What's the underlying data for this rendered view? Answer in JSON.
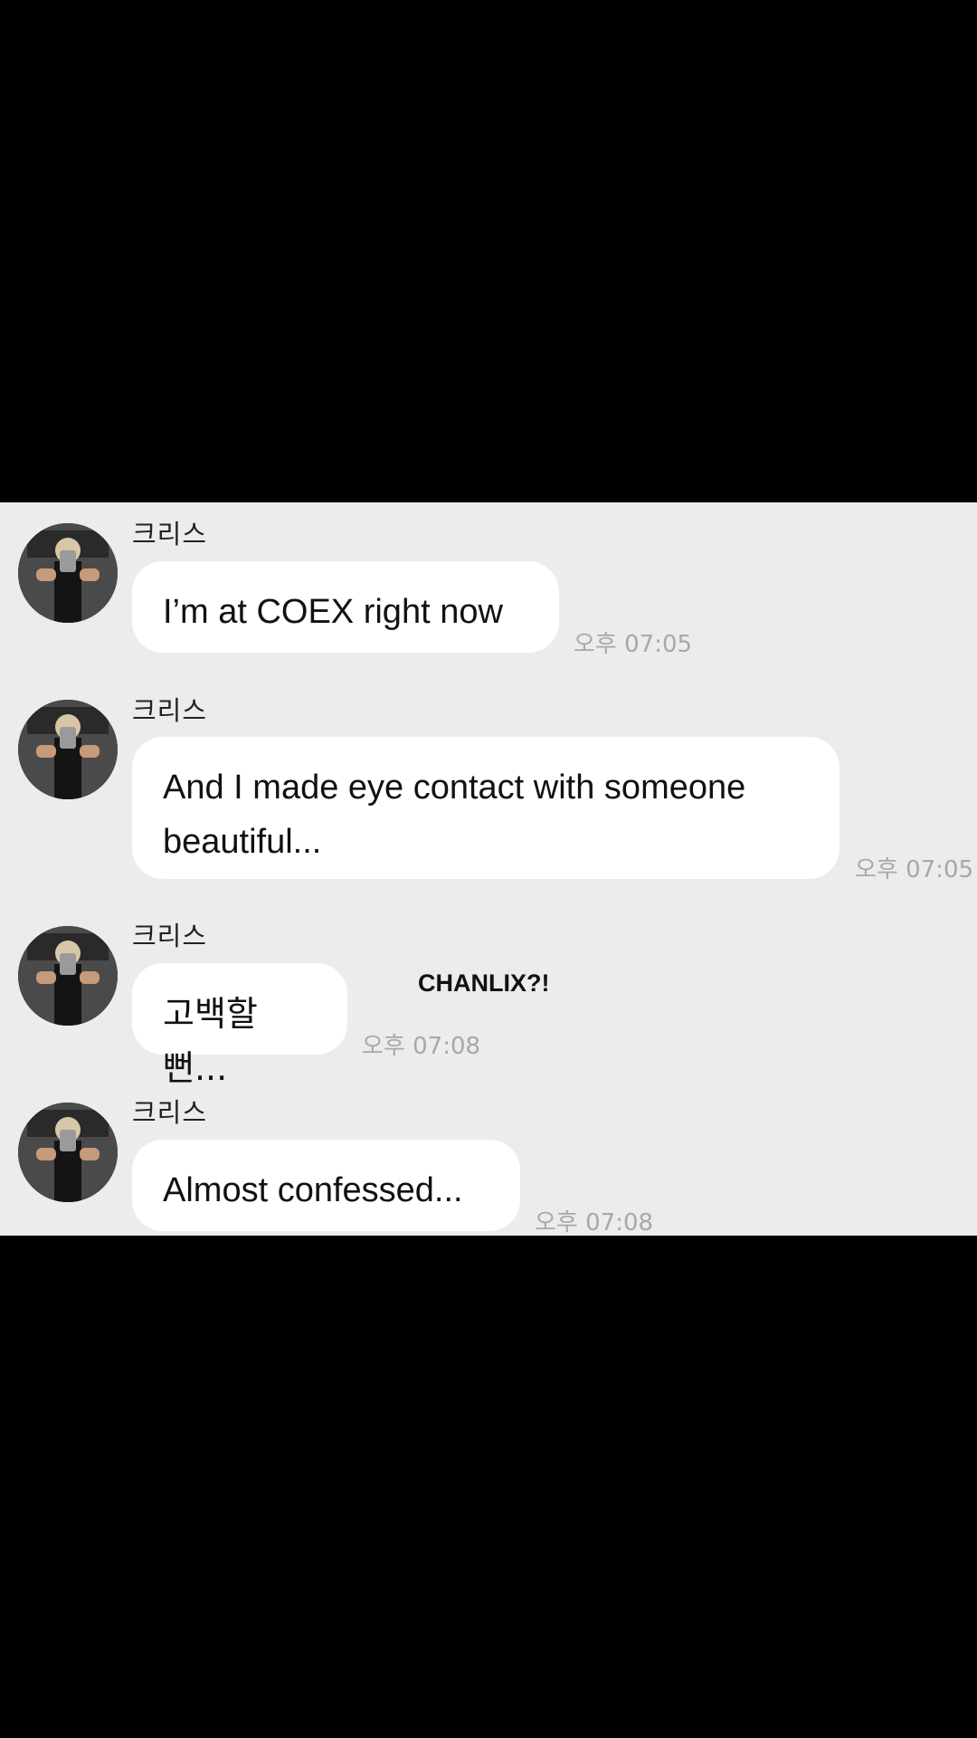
{
  "colors": {
    "background": "#000000",
    "chat_background": "#ececec",
    "bubble": "#ffffff",
    "timestamp": "#a8a8a8"
  },
  "messages": [
    {
      "sender": "크리스",
      "text": "I’m at COEX right now",
      "time": "오후 07:05",
      "avatar_icon": "user-avatar"
    },
    {
      "sender": "크리스",
      "text": "And I made eye contact with someone\nbeautiful...",
      "time": "오후 07:05",
      "avatar_icon": "user-avatar"
    },
    {
      "sender": "크리스",
      "text": "고백할뻔...",
      "time": "오후 07:08",
      "avatar_icon": "user-avatar"
    },
    {
      "sender": "크리스",
      "text": "Almost confessed...",
      "time": "오후 07:08",
      "avatar_icon": "user-avatar"
    }
  ],
  "overlay_caption": "CHANLIX?!"
}
